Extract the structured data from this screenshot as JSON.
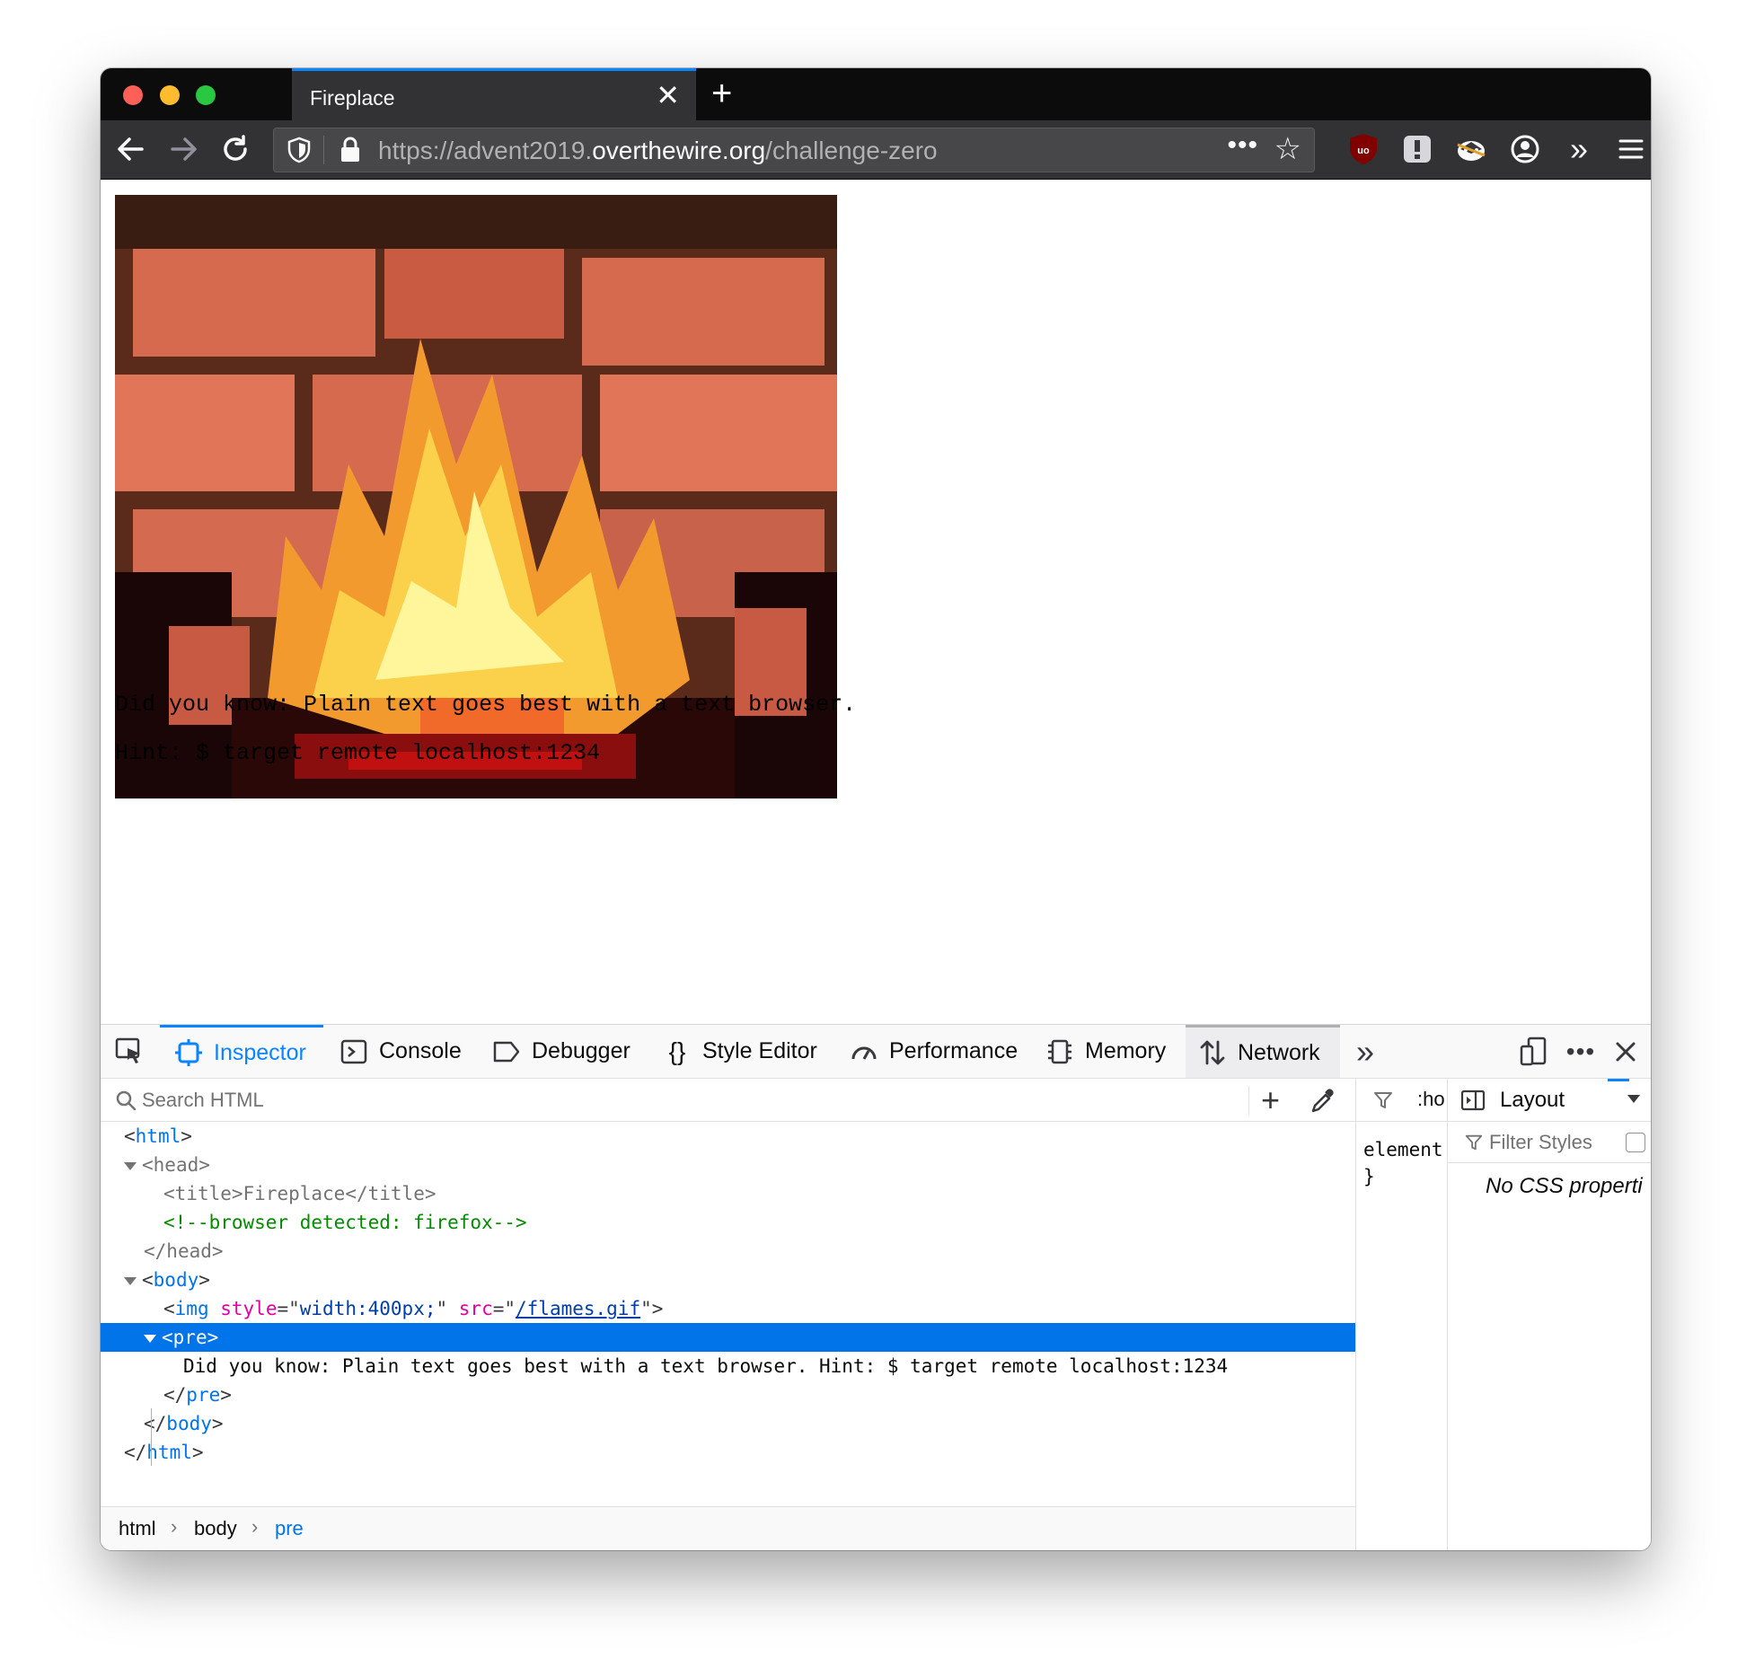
{
  "tab": {
    "title": "Fireplace"
  },
  "nav": {
    "url_scheme": "https://advent2019.",
    "url_domain": "overthewire.org",
    "url_path": "/challenge-zero",
    "url_dots": "•••"
  },
  "page": {
    "line1": "Did you know: Plain text goes best with a text browser.",
    "line2": "Hint: $ target remote localhost:1234"
  },
  "devtools": {
    "tabs": [
      "Inspector",
      "Console",
      "Debugger",
      "Style Editor",
      "Performance",
      "Memory",
      "Network"
    ],
    "search_placeholder": "Search HTML",
    "tree": {
      "html": "html",
      "head": "head",
      "title_tag": "title",
      "title_text": "Fireplace",
      "comment": "<!--browser detected: firefox-->",
      "body": "body",
      "img": "img",
      "attr_style": "style",
      "style_value": "width:400px;",
      "attr_src": "src",
      "src_value": "/flames.gif",
      "pre": "pre",
      "pre_text": "Did you know: Plain text goes best with a text browser. Hint: $ target remote localhost:1234"
    },
    "breadcrumbs": [
      "html",
      "body",
      "pre"
    ],
    "rules": {
      "hov": ":ho",
      "element_line": "element",
      "close_brace": "}"
    },
    "layout": {
      "tab": "Layout",
      "filter_placeholder": "Filter Styles",
      "empty": "No CSS properti"
    }
  }
}
